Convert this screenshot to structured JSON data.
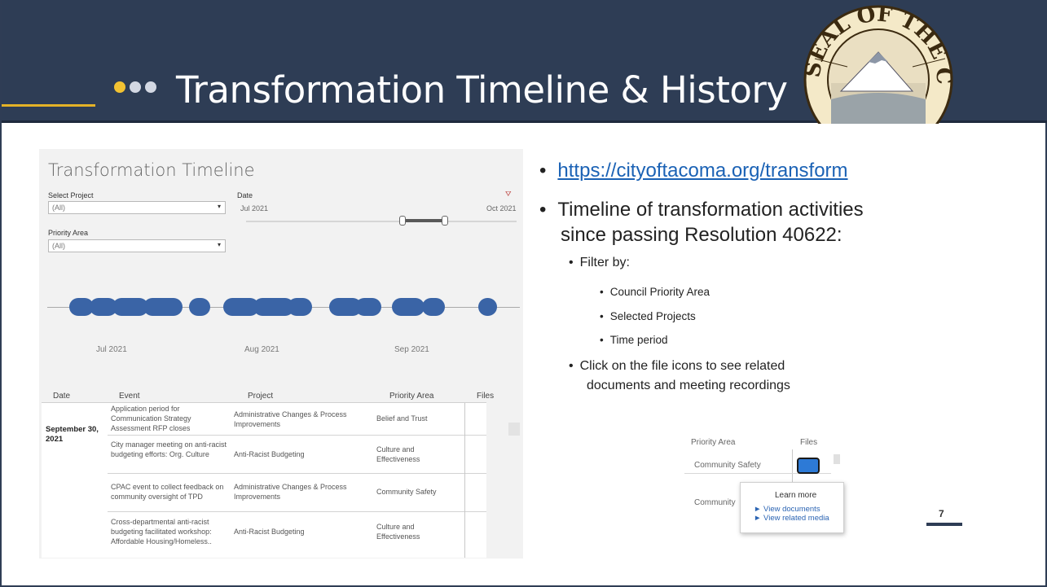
{
  "header": {
    "title": "Transformation Timeline & History",
    "colors": {
      "bar": "#2e3d55",
      "accent_dot": "#f2c232",
      "muted_dot": "#d3d8e3",
      "underline": "#e4b227"
    },
    "seal": {
      "icon": "city-seal-icon",
      "text": "SEAL OF THE CITY OF TACOMA"
    }
  },
  "dashboard": {
    "title": "Transformation Timeline",
    "filters": {
      "project_label": "Select Project",
      "project_value": "(All)",
      "priority_label": "Priority Area",
      "priority_value": "(All)",
      "date_label": "Date",
      "date_start": "Jul 2021",
      "date_end": "Oct 2021"
    },
    "months": [
      "Jul 2021",
      "Aug 2021",
      "Sep 2021"
    ],
    "columns": [
      "Date",
      "Event",
      "Project",
      "Priority Area",
      "Files"
    ],
    "date_group": "September 30, 2021",
    "rows": [
      {
        "event": "Application period for Communication Strategy Assessment RFP closes",
        "project": "Administrative Changes & Process Improvements",
        "priority": "Belief and Trust"
      },
      {
        "event": "City manager meeting on anti-racist budgeting efforts: Org. Culture",
        "project": "Anti-Racist Budgeting",
        "priority": "Culture and Effectiveness"
      },
      {
        "event": "CPAC event to collect feedback on community oversight of TPD",
        "project": "Administrative Changes & Process Improvements",
        "priority": "Community Safety"
      },
      {
        "event": "Cross-departmental anti-racist budgeting facilitated workshop: Affordable Housing/Homeless..",
        "project": "Anti-Racist Budgeting",
        "priority": "Culture and Effectiveness"
      }
    ],
    "bubble_color": "#3a64a6"
  },
  "content": {
    "link": "https://cityoftacoma.org/transform",
    "line1": "Timeline of transformation activities",
    "line2": "since passing Resolution 40622:",
    "filter_by": "Filter by:",
    "filters": [
      "Council Priority Area",
      "Selected Projects",
      "Time period"
    ],
    "click_line1": "Click on the file icons to see related",
    "click_line2": "documents and meeting recordings"
  },
  "inset": {
    "col1": "Priority Area",
    "col2": "Files",
    "row1": "Community Safety",
    "row2": "Community",
    "popup_title": "Learn more",
    "popup_link1": "► View documents",
    "popup_link2": "► View related media"
  },
  "page_number": "7"
}
